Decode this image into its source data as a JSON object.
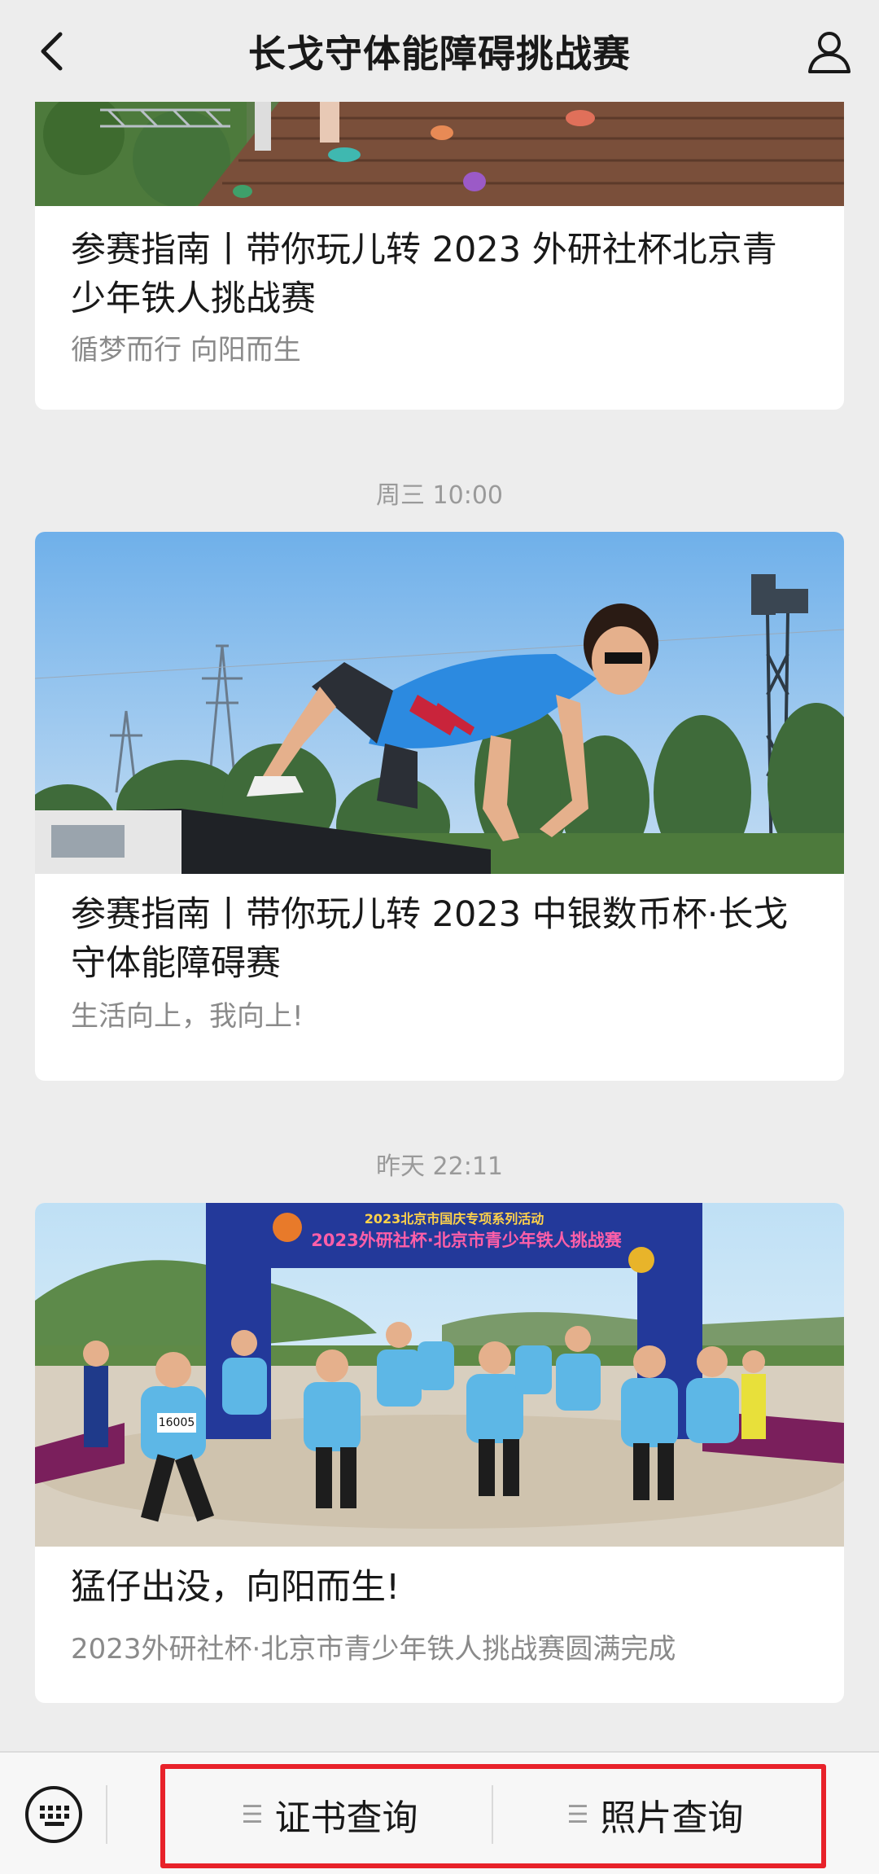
{
  "header": {
    "title": "长戈守体能障碍挑战赛",
    "back_icon": "chevron-left-icon",
    "profile_icon": "user-icon"
  },
  "feed": {
    "items": [
      {
        "title": "参赛指南丨带你玩儿转 2023 外研社杯北京青少年铁人挑战赛",
        "subtitle": "循梦而行 向阳而生"
      },
      {
        "time": "周三 10:00",
        "title": "参赛指南丨带你玩儿转 2023 中银数币杯·长戈守体能障碍赛",
        "subtitle": "生活向上，我向上!"
      },
      {
        "time": "昨天 22:11",
        "title": "猛仔出没，向阳而生!",
        "subtitle": "2023外研社杯·北京市青少年铁人挑战赛圆满完成",
        "image_banner_top": "2023北京市国庆专项系列活动",
        "image_banner_main": "2023外研社杯·北京市青少年铁人挑战赛",
        "bib_number": "16005"
      }
    ]
  },
  "bottom_bar": {
    "keyboard_icon": "keyboard-icon",
    "menu_icon": "menu-icon",
    "btn1": "证书查询",
    "btn2": "照片查询",
    "highlight_color": "#e8222a"
  }
}
